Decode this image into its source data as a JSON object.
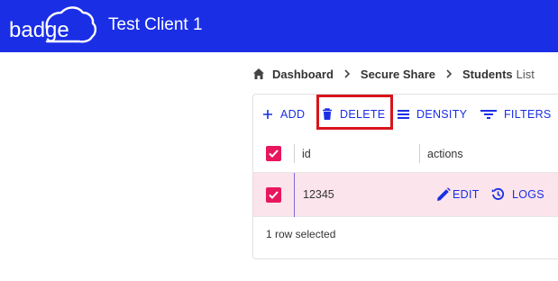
{
  "header": {
    "logo_text": "badge",
    "client_name": "Test Client 1",
    "bar_color": "#1a2ee6"
  },
  "breadcrumb": {
    "home_icon": "home-icon",
    "items": [
      "Dashboard",
      "Secure Share",
      "Students"
    ],
    "current_suffix": "List"
  },
  "toolbar": {
    "add_label": "ADD",
    "delete_label": "DELETE",
    "density_label": "DENSITY",
    "filters_label": "FILTERS",
    "accent": "#1a2ee6",
    "highlight_color": "#d8141c"
  },
  "table": {
    "columns": [
      "id",
      "actions"
    ],
    "rows": [
      {
        "id": "12345",
        "selected": true,
        "edit_label": "EDIT",
        "logs_label": "LOGS"
      }
    ],
    "selected_row_color": "#fce4ec",
    "checkbox_color": "#e8175d",
    "footer_text": "1 row selected"
  }
}
